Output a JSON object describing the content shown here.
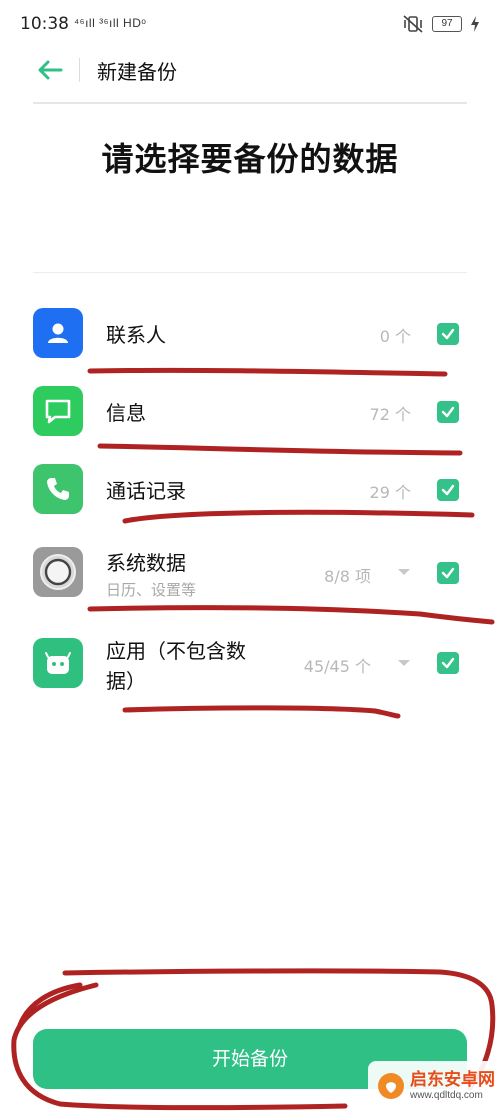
{
  "status_bar": {
    "time": "10:38",
    "signal": "⁴⁶ıll ³⁶ıll HDᵒ",
    "battery": "97"
  },
  "header": {
    "title": "新建备份",
    "back_icon": "arrow-left-icon"
  },
  "heading": "请选择要备份的数据",
  "items": [
    {
      "label": "联系人",
      "count": "0 个",
      "icon": "contacts-icon",
      "icon_color": "#1f6ff2",
      "checked": true
    },
    {
      "label": "信息",
      "count": "72 个",
      "icon": "message-icon",
      "icon_color": "#2ecc5e",
      "checked": true
    },
    {
      "label": "通话记录",
      "count": "29 个",
      "icon": "phone-icon",
      "icon_color": "#3ec46c",
      "checked": true
    },
    {
      "label": "系统数据",
      "sublabel": "日历、设置等",
      "count": "8/8 项",
      "icon": "system-data-icon",
      "icon_color": "#9a9a9a",
      "checked": true,
      "expandable": true
    },
    {
      "label": "应用（不包含数",
      "label_line2": "据）",
      "count": "45/45 个",
      "icon": "android-app-icon",
      "icon_color": "#2fbf7f",
      "checked": true,
      "expandable": true
    }
  ],
  "start_button": "开始备份",
  "watermark": {
    "title": "启东安卓网",
    "url": "www.qdltdq.com"
  },
  "colors": {
    "accent": "#2fc086",
    "marker": "#a81010"
  }
}
